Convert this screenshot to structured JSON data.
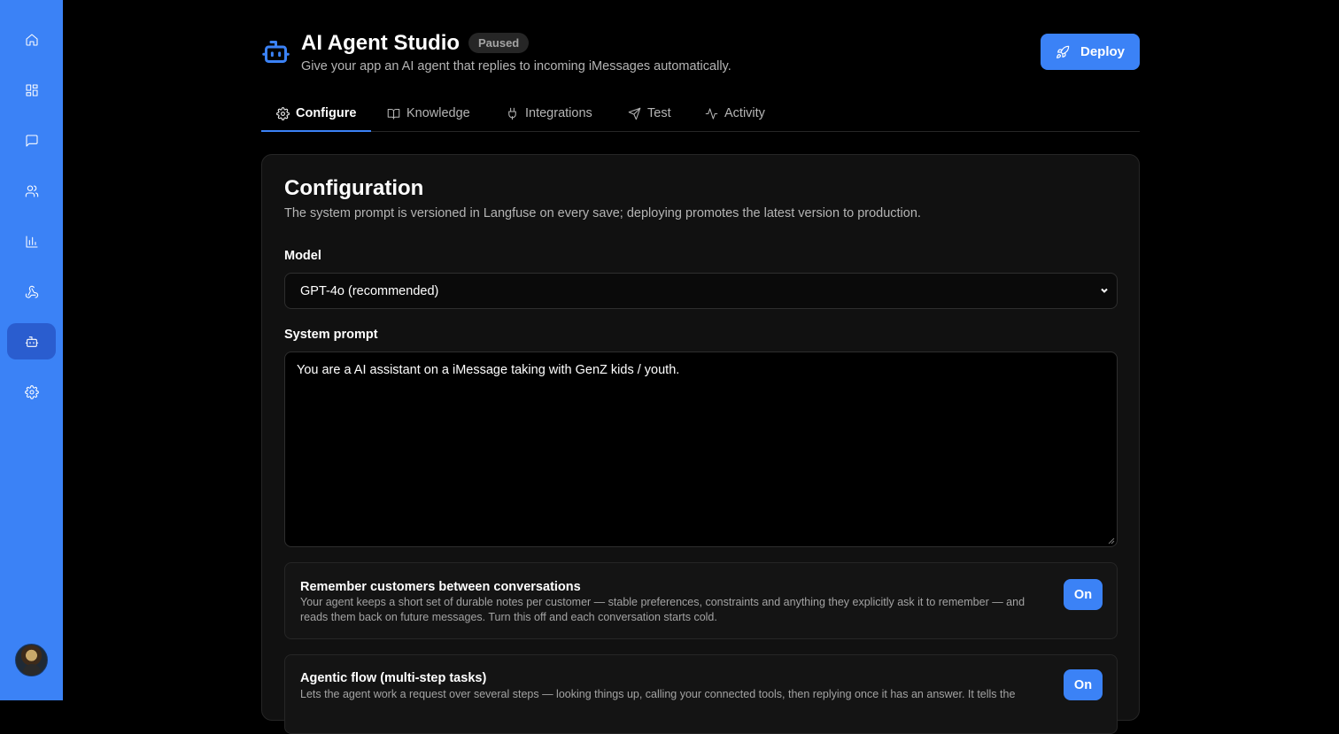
{
  "sidebar": {
    "items": [
      {
        "name": "home",
        "icon": "home-icon"
      },
      {
        "name": "apps",
        "icon": "grid-icon"
      },
      {
        "name": "messages",
        "icon": "chat-icon"
      },
      {
        "name": "contacts",
        "icon": "users-icon"
      },
      {
        "name": "analytics",
        "icon": "bar-chart-icon"
      },
      {
        "name": "webhooks",
        "icon": "webhook-icon"
      },
      {
        "name": "ai-agent",
        "icon": "robot-icon",
        "active": true
      },
      {
        "name": "settings",
        "icon": "gear-icon"
      }
    ],
    "avatar": "user-avatar"
  },
  "header": {
    "title": "AI Agent Studio",
    "status": "Paused",
    "subtitle": "Give your app an AI agent that replies to incoming iMessages automatically.",
    "deploy_label": "Deploy"
  },
  "tabs": [
    {
      "label": "Configure",
      "icon": "gear-icon",
      "active": true
    },
    {
      "label": "Knowledge",
      "icon": "book-icon"
    },
    {
      "label": "Integrations",
      "icon": "plug-icon"
    },
    {
      "label": "Test",
      "icon": "send-icon"
    },
    {
      "label": "Activity",
      "icon": "activity-icon"
    }
  ],
  "configuration": {
    "title": "Configuration",
    "description": "The system prompt is versioned in Langfuse on every save; deploying promotes the latest version to production.",
    "model_label": "Model",
    "model_value": "GPT-4o (recommended)",
    "prompt_label": "System prompt",
    "prompt_value": "You are a AI assistant on a iMessage taking with GenZ kids / youth.",
    "options": [
      {
        "title": "Remember customers between conversations",
        "description": "Your agent keeps a short set of durable notes per customer — stable preferences, constraints and anything they explicitly ask it to remember — and reads them back on future messages. Turn this off and each conversation starts cold.",
        "toggle": "On"
      },
      {
        "title": "Agentic flow (multi-step tasks)",
        "description": "Lets the agent work a request over several steps — looking things up, calling your connected tools, then replying once it has an answer. It tells the",
        "toggle": "On"
      }
    ]
  },
  "colors": {
    "accent": "#3b82f6",
    "background": "#000000",
    "card": "#111111"
  }
}
